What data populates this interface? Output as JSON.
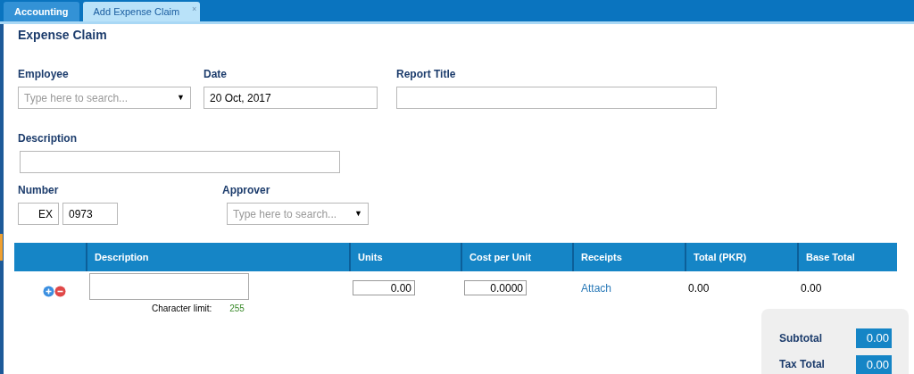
{
  "tabs": [
    {
      "label": "Accounting",
      "selected": false
    },
    {
      "label": "Add Expense Claim",
      "selected": true,
      "close": "×"
    }
  ],
  "title": "Expense Claim",
  "fields_row1": [
    {
      "label": "Employee",
      "kind": "combo",
      "placeholder": "Type here to search...",
      "arrow": "▼"
    },
    {
      "label": "Date",
      "kind": "text",
      "value": "20 Oct, 2017"
    },
    {
      "label": "Report Title",
      "kind": "text"
    }
  ],
  "description": {
    "label": "Description"
  },
  "number": {
    "label": "Number",
    "prefix": "EX",
    "value": "0973"
  },
  "approver": {
    "label": "Approver",
    "placeholder": "Type here to search...",
    "arrow": "▼"
  },
  "table": {
    "columns": [
      "",
      "Description",
      "Units",
      "Cost per Unit",
      "Receipts",
      "Total (PKR)",
      "Base Total"
    ],
    "rows": [
      {
        "char_limit_label": "Character limit:",
        "char_limit": "255",
        "units": "0.00",
        "cost": "0.0000",
        "receipt_link": "Attach",
        "total": "0.00",
        "base_total": "0.00"
      }
    ]
  },
  "summary": [
    {
      "label": "Subtotal",
      "value": "0.00"
    },
    {
      "label": "Tax Total",
      "value": "0.00"
    }
  ]
}
